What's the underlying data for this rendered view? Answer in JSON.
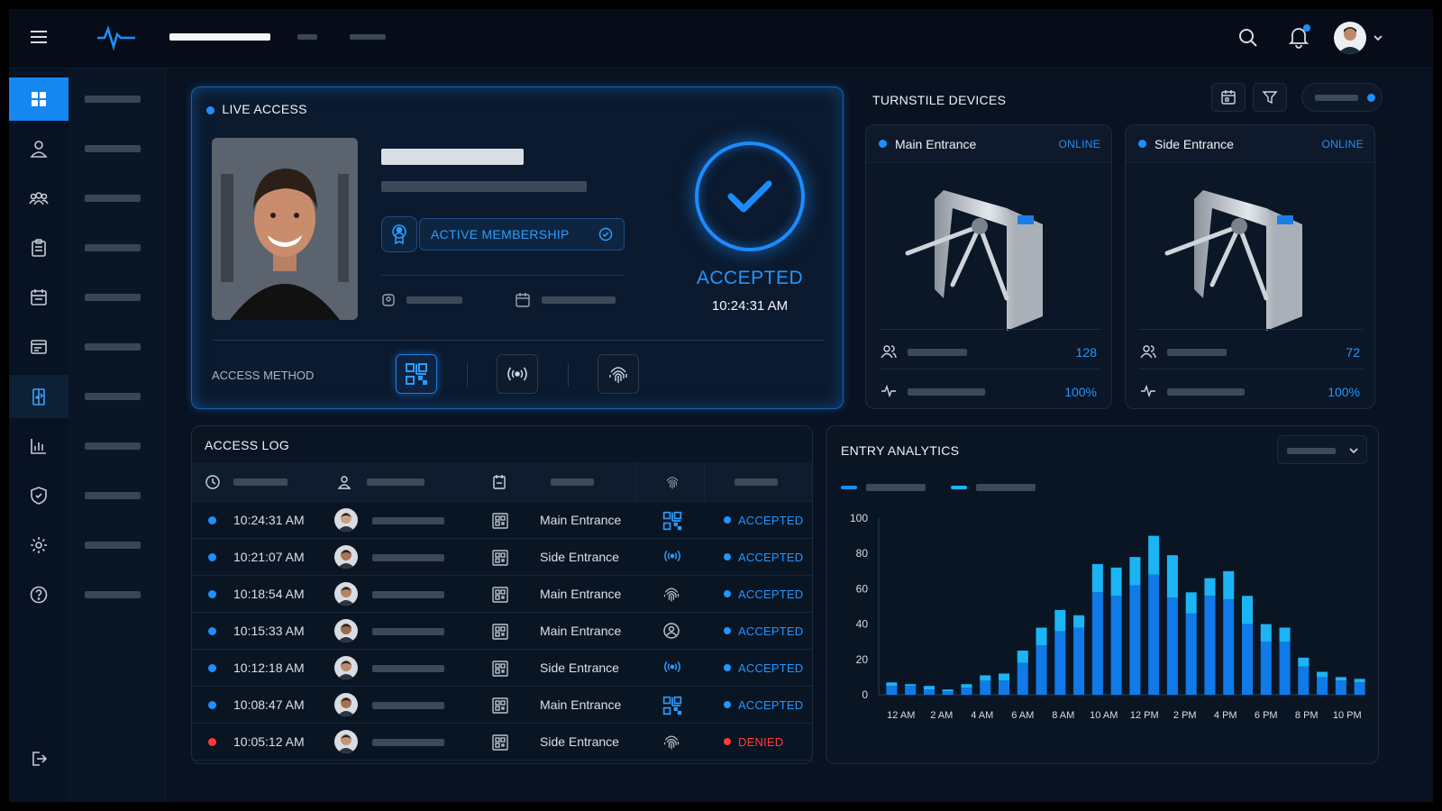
{
  "colors": {
    "accent": "#1687f0",
    "accepted": "#2196ff",
    "denied": "#ff3b3b",
    "online": "#1f8fff",
    "background": "#081220"
  },
  "topbar": {
    "icons": [
      "menu-icon",
      "pulse-logo-icon",
      "search-icon",
      "bell-icon",
      "avatar",
      "chevron-down-icon"
    ]
  },
  "sidebar": {
    "icons": [
      "dashboard-icon",
      "user-icon",
      "users-icon",
      "clipboard-icon",
      "calendar-icon",
      "card-icon",
      "door-icon",
      "chart-icon",
      "shield-icon",
      "gear-icon",
      "help-icon",
      "logout-icon"
    ]
  },
  "live_access": {
    "title": "LIVE ACCESS",
    "membership_label": "ACTIVE MEMBERSHIP",
    "status": "ACCEPTED",
    "time": "10:24:31 AM",
    "access_method_label": "ACCESS METHOD",
    "methods": [
      "qr-code-icon",
      "rfid-icon",
      "fingerprint-icon"
    ]
  },
  "turnstiles": {
    "title": "TURNSTILE DEVICES",
    "devices": [
      {
        "name": "Main Entrance",
        "status": "ONLINE",
        "count": "128",
        "health": "100%"
      },
      {
        "name": "Side Entrance",
        "status": "ONLINE",
        "count": "72",
        "health": "100%"
      }
    ]
  },
  "access_log": {
    "title": "ACCESS LOG",
    "rows": [
      {
        "time": "10:24:31 AM",
        "gate": "Main Entrance",
        "method": "qr-code-icon",
        "status": "ACCEPTED"
      },
      {
        "time": "10:21:07 AM",
        "gate": "Side Entrance",
        "method": "rfid-icon",
        "status": "ACCEPTED"
      },
      {
        "time": "10:18:54 AM",
        "gate": "Main Entrance",
        "method": "fingerprint-icon",
        "status": "ACCEPTED"
      },
      {
        "time": "10:15:33 AM",
        "gate": "Main Entrance",
        "method": "face-icon",
        "status": "ACCEPTED"
      },
      {
        "time": "10:12:18 AM",
        "gate": "Side Entrance",
        "method": "rfid-icon",
        "status": "ACCEPTED"
      },
      {
        "time": "10:08:47 AM",
        "gate": "Main Entrance",
        "method": "qr-code-icon",
        "status": "ACCEPTED"
      },
      {
        "time": "10:05:12 AM",
        "gate": "Side Entrance",
        "method": "fingerprint-icon",
        "status": "DENIED"
      }
    ]
  },
  "chart_data": {
    "type": "bar",
    "title": "ENTRY ANALYTICS",
    "stacked": true,
    "ylim": [
      0,
      100
    ],
    "yticks": [
      0,
      20,
      40,
      60,
      80,
      100
    ],
    "xticks": [
      "12 AM",
      "2 AM",
      "4 AM",
      "6 AM",
      "8 AM",
      "10 AM",
      "12 PM",
      "2 PM",
      "4 PM",
      "6 PM",
      "8 PM",
      "10 PM"
    ],
    "series": [
      {
        "values": [
          5,
          5,
          3,
          2,
          4,
          8,
          8,
          18,
          28,
          36,
          38,
          58,
          56,
          62,
          68,
          55,
          46,
          56,
          54,
          40,
          30,
          30,
          16,
          10,
          8,
          7
        ]
      },
      {
        "values": [
          2,
          1,
          2,
          1,
          2,
          3,
          4,
          7,
          10,
          12,
          7,
          16,
          16,
          16,
          22,
          24,
          12,
          10,
          16,
          16,
          10,
          8,
          5,
          3,
          2,
          2
        ]
      }
    ],
    "colors": [
      "#0f7ae8",
      "#1bb4f5"
    ]
  }
}
